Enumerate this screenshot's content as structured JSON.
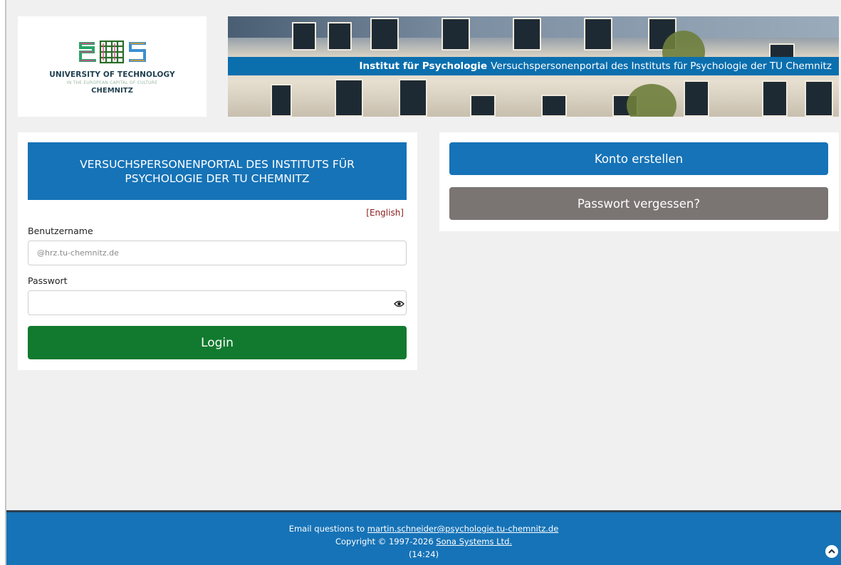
{
  "logo": {
    "line1": "UNIVERSITY OF TECHNOLOGY",
    "line2": "IN THE EUROPEAN CAPITAL OF CULTURE",
    "line3": "CHEMNITZ"
  },
  "banner": {
    "title_bold": "Institut für Psychologie",
    "title_rest": "Versuchspersonenportal des Instituts für Psychologie der TU Chemnitz"
  },
  "login": {
    "header": "VERSUCHSPERSONENPORTAL DES INSTITUTS FÜR PSYCHOLOGIE DER TU CHEMNITZ",
    "language_link": "[English]",
    "username_label": "Benutzername",
    "username_placeholder": "@hrz.tu-chemnitz.de",
    "username_value": "",
    "password_label": "Passwort",
    "password_value": "",
    "login_button": "Login"
  },
  "actions": {
    "create_account": "Konto erstellen",
    "forgot_password": "Passwort vergessen?"
  },
  "footer": {
    "email_prefix": "Email questions to",
    "email": "martin.schneider@psychologie.tu-chemnitz.de",
    "copyright_prefix": "Copyright © 1997-2026",
    "copyright_link": "Sona Systems Ltd.",
    "time": "(14:24)"
  },
  "colors": {
    "primary": "#1673b7",
    "login_green": "#117a2e",
    "secondary_gray": "#7a7473",
    "link_red": "#8b1a1a"
  },
  "icons": {
    "password_toggle": "eye-icon",
    "scroll_top": "chevron-up-icon"
  }
}
